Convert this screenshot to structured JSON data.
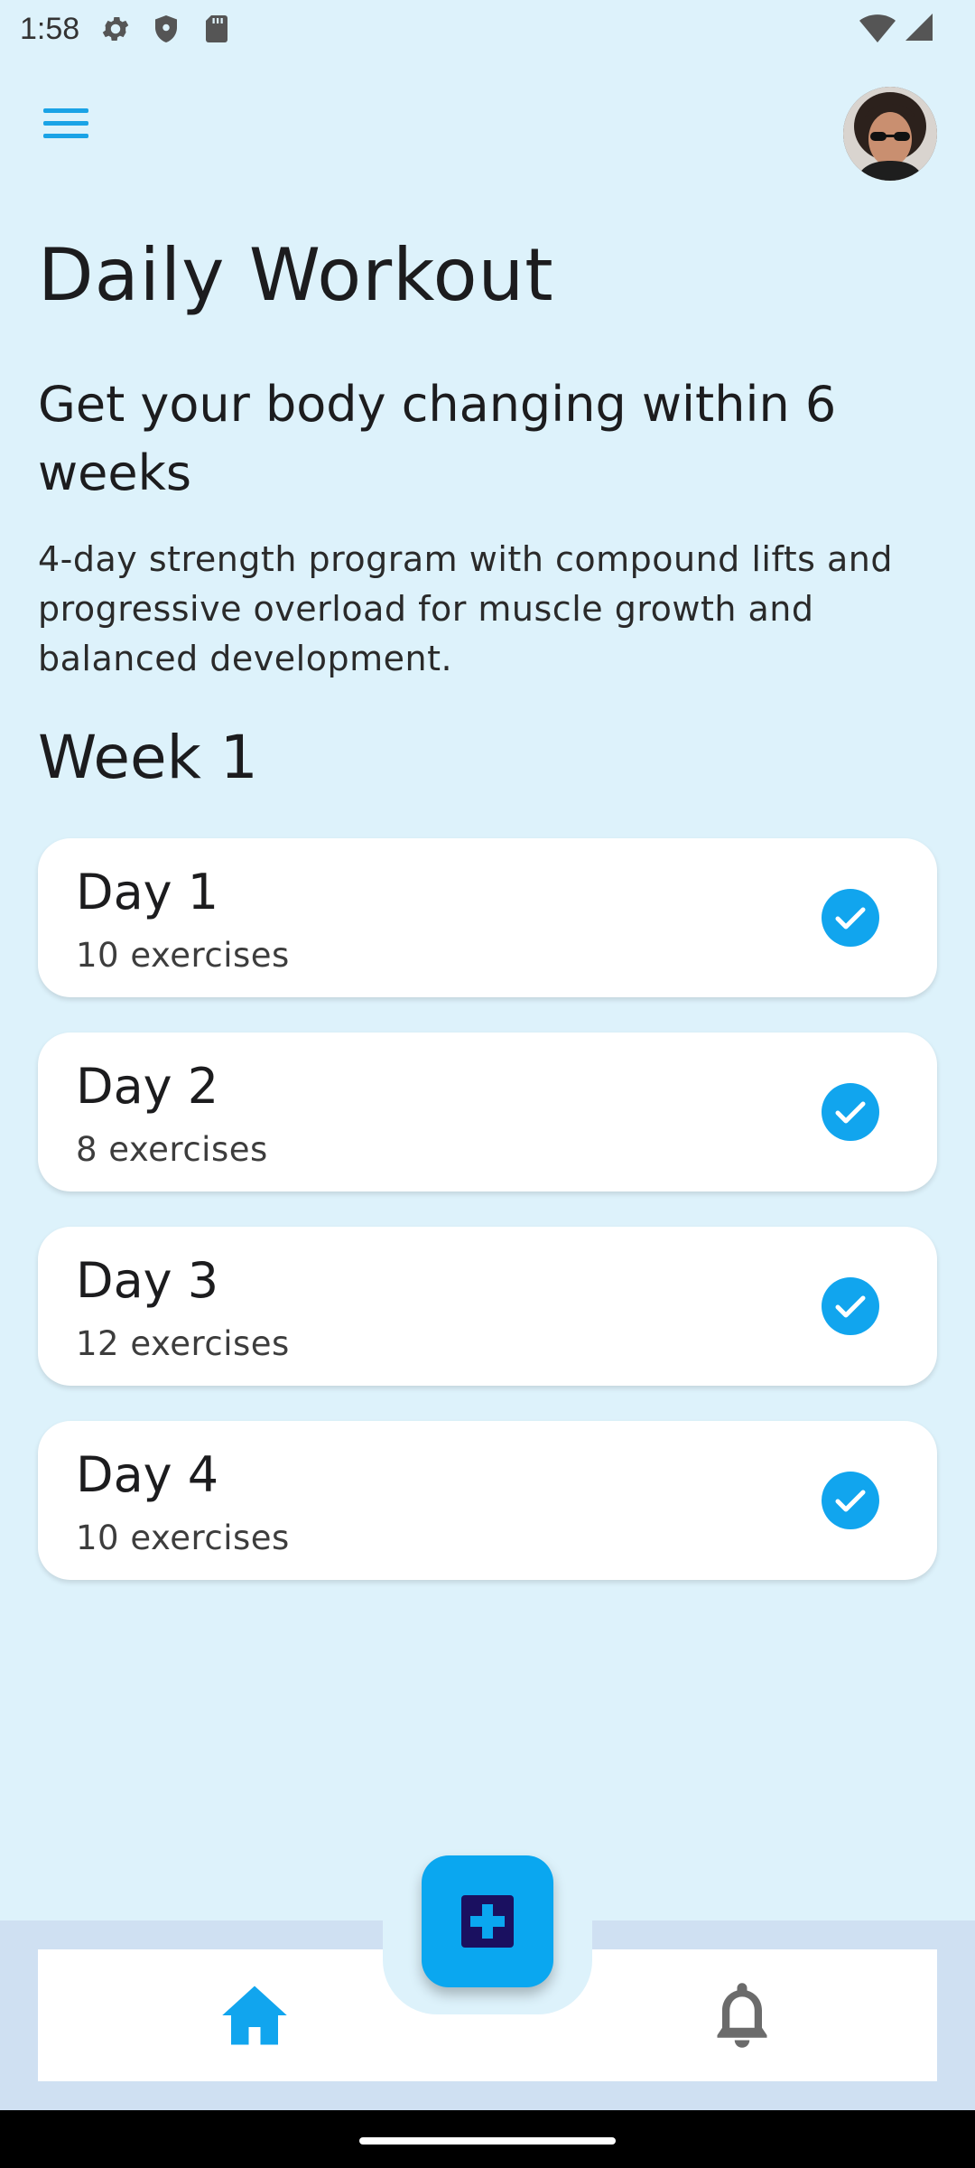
{
  "status_bar": {
    "time": "1:58",
    "icons": [
      "settings-icon",
      "shield-icon",
      "sd-card-icon",
      "wifi-icon",
      "signal-icon"
    ]
  },
  "header": {
    "menu_icon": "hamburger-menu-icon",
    "avatar": "user-avatar"
  },
  "page": {
    "title": "Daily Workout",
    "subtitle": "Get your body changing within 6\n weeks",
    "description": "4-day strength program with compound lifts and progressive overload for muscle growth and balanced development.",
    "week_label": "Week 1"
  },
  "days": [
    {
      "name": "Day 1",
      "exercises": "10 exercises",
      "completed": true
    },
    {
      "name": "Day 2",
      "exercises": "8 exercises",
      "completed": true
    },
    {
      "name": "Day 3",
      "exercises": "12 exercises",
      "completed": true
    },
    {
      "name": "Day 4",
      "exercises": "10 exercises",
      "completed": true
    }
  ],
  "bottom_nav": {
    "items": [
      "home-icon",
      "bell-icon"
    ],
    "fab_icon": "add-icon",
    "active": "home"
  },
  "colors": {
    "background": "#ddf2fb",
    "accent": "#11a5ee",
    "fab_icon_fill": "#1a1060"
  }
}
